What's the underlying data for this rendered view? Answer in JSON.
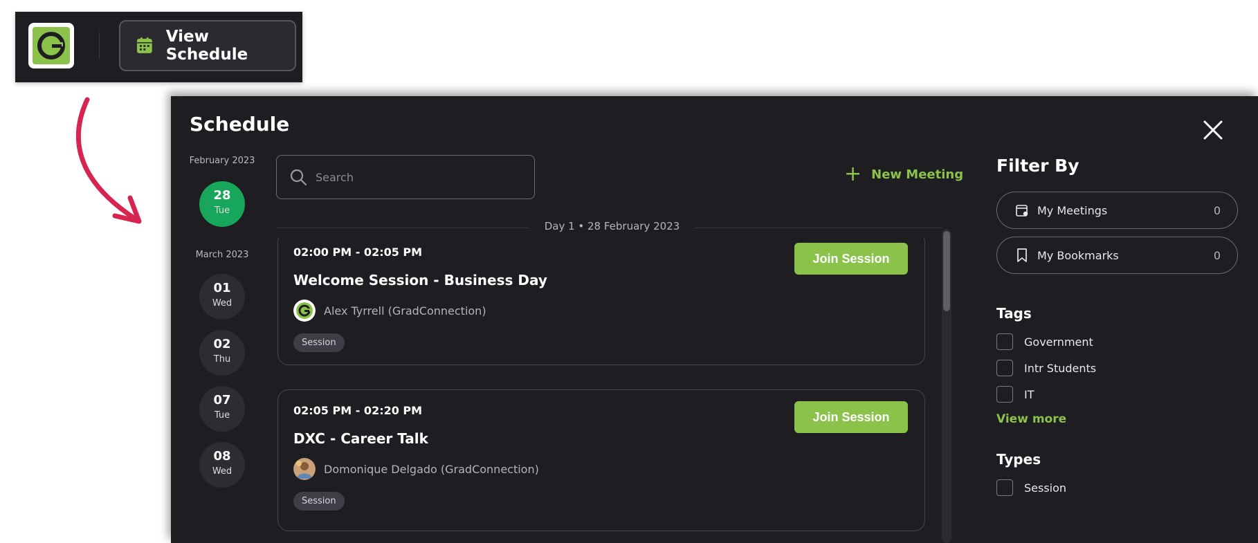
{
  "toolbar": {
    "logo_icon": "gradconnection-logo-icon",
    "view_schedule_label": "View Schedule",
    "calendar_icon": "calendar-icon",
    "accent": "#8bc34a"
  },
  "schedule": {
    "title": "Schedule",
    "close_icon": "close-icon",
    "dates": [
      {
        "month": "February 2023",
        "day": "28",
        "weekday": "Tue",
        "active": true
      },
      {
        "month": "March 2023",
        "day": "01",
        "weekday": "Wed",
        "active": false
      },
      {
        "month": "",
        "day": "02",
        "weekday": "Thu",
        "active": false
      },
      {
        "month": "",
        "day": "07",
        "weekday": "Tue",
        "active": false
      },
      {
        "month": "",
        "day": "08",
        "weekday": "Wed",
        "active": false
      }
    ],
    "active_date_color": "#17a65a",
    "search": {
      "placeholder": "Search",
      "value": ""
    },
    "new_meeting_label": "New Meeting",
    "day_separator": "Day 1 • 28 February 2023",
    "sessions": [
      {
        "time": "02:00 PM - 02:05 PM",
        "title": "Welcome Session - Business Day",
        "join_label": "Join Session",
        "host": "Alex Tyrrell (GradConnection)",
        "badge": "Session"
      },
      {
        "time": "02:05 PM - 02:20 PM",
        "title": "DXC - Career Talk",
        "join_label": "Join Session",
        "host": "Domonique Delgado (GradConnection)",
        "badge": "Session"
      }
    ]
  },
  "filters": {
    "title": "Filter By",
    "my_meetings": {
      "label": "My Meetings",
      "count": "0"
    },
    "my_bookmarks": {
      "label": "My Bookmarks",
      "count": "0"
    },
    "tags_heading": "Tags",
    "tags": [
      "Government",
      "Intr Students",
      "IT"
    ],
    "view_more_label": "View more",
    "types_heading": "Types",
    "types": [
      "Session"
    ]
  }
}
